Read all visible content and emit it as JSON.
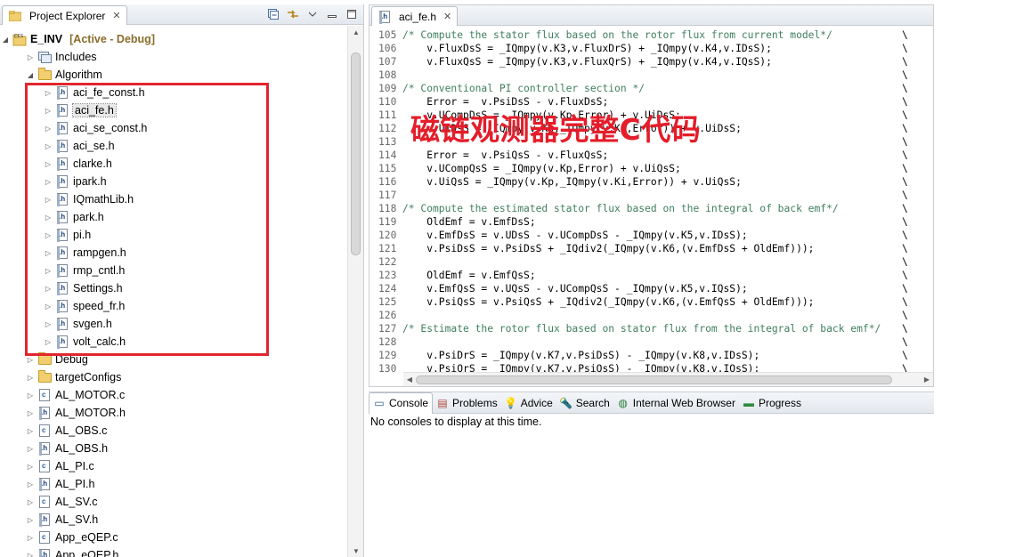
{
  "explorer": {
    "tab_label": "Project Explorer",
    "close_glyph": "✕",
    "tools": [
      "collapse-all-icon",
      "link-with-editor-icon",
      "view-menu-icon",
      "minimize-icon",
      "maximize-icon"
    ],
    "project": {
      "name": "E_INV",
      "status": "[Active - Debug]"
    },
    "items": [
      {
        "label": "Includes",
        "type": "includes",
        "depth": 1,
        "expanded": false
      },
      {
        "label": "Algorithm",
        "type": "folder",
        "depth": 1,
        "expanded": true
      },
      {
        "label": "aci_fe_const.h",
        "type": "h",
        "depth": 2
      },
      {
        "label": "aci_fe.h",
        "type": "h",
        "depth": 2,
        "selected": true
      },
      {
        "label": "aci_se_const.h",
        "type": "h",
        "depth": 2
      },
      {
        "label": "aci_se.h",
        "type": "h",
        "depth": 2
      },
      {
        "label": "clarke.h",
        "type": "h",
        "depth": 2
      },
      {
        "label": "ipark.h",
        "type": "h",
        "depth": 2
      },
      {
        "label": "IQmathLib.h",
        "type": "h",
        "depth": 2
      },
      {
        "label": "park.h",
        "type": "h",
        "depth": 2
      },
      {
        "label": "pi.h",
        "type": "h",
        "depth": 2
      },
      {
        "label": "rampgen.h",
        "type": "h",
        "depth": 2
      },
      {
        "label": "rmp_cntl.h",
        "type": "h",
        "depth": 2
      },
      {
        "label": "Settings.h",
        "type": "h",
        "depth": 2
      },
      {
        "label": "speed_fr.h",
        "type": "h",
        "depth": 2
      },
      {
        "label": "svgen.h",
        "type": "h",
        "depth": 2
      },
      {
        "label": "volt_calc.h",
        "type": "h",
        "depth": 2
      },
      {
        "label": "Debug",
        "type": "folder",
        "depth": 1,
        "expanded": false
      },
      {
        "label": "targetConfigs",
        "type": "folder",
        "depth": 1,
        "expanded": false
      },
      {
        "label": "AL_MOTOR.c",
        "type": "c",
        "depth": 1
      },
      {
        "label": "AL_MOTOR.h",
        "type": "h",
        "depth": 1
      },
      {
        "label": "AL_OBS.c",
        "type": "c",
        "depth": 1
      },
      {
        "label": "AL_OBS.h",
        "type": "h",
        "depth": 1
      },
      {
        "label": "AL_PI.c",
        "type": "c",
        "depth": 1
      },
      {
        "label": "AL_PI.h",
        "type": "h",
        "depth": 1
      },
      {
        "label": "AL_SV.c",
        "type": "c",
        "depth": 1
      },
      {
        "label": "AL_SV.h",
        "type": "h",
        "depth": 1
      },
      {
        "label": "App_eQEP.c",
        "type": "c",
        "depth": 1
      },
      {
        "label": "App_eQEP.h",
        "type": "h",
        "depth": 1
      }
    ]
  },
  "editor": {
    "tab_label": "aci_fe.h",
    "close_glyph": "✕",
    "continuation": "\\",
    "overlay_text": "磁链观测器完整C代码",
    "lines": [
      {
        "n": "105",
        "text": "/* Compute the stator flux based on the rotor flux from current model*/",
        "comment": true
      },
      {
        "n": "106",
        "text": "    v.FluxDsS = _IQmpy(v.K3,v.FluxDrS) + _IQmpy(v.K4,v.IDsS);"
      },
      {
        "n": "107",
        "text": "    v.FluxQsS = _IQmpy(v.K3,v.FluxQrS) + _IQmpy(v.K4,v.IQsS);"
      },
      {
        "n": "108",
        "text": ""
      },
      {
        "n": "109",
        "text": "/* Conventional PI controller section */",
        "comment": true
      },
      {
        "n": "110",
        "text": "    Error =  v.PsiDsS - v.FluxDsS;"
      },
      {
        "n": "111",
        "text": "    v.UCompDsS = _IQmpy(v.Kp,Error) + v.UiDsS;"
      },
      {
        "n": "112",
        "text": "    v.UiDsS = _IQmpy(v.Kp,_IQmpy(v.Ki,Error)) + v.UiDsS;"
      },
      {
        "n": "113",
        "text": ""
      },
      {
        "n": "114",
        "text": "    Error =  v.PsiQsS - v.FluxQsS;"
      },
      {
        "n": "115",
        "text": "    v.UCompQsS = _IQmpy(v.Kp,Error) + v.UiQsS;"
      },
      {
        "n": "116",
        "text": "    v.UiQsS = _IQmpy(v.Kp,_IQmpy(v.Ki,Error)) + v.UiQsS;"
      },
      {
        "n": "117",
        "text": ""
      },
      {
        "n": "118",
        "text": "/* Compute the estimated stator flux based on the integral of back emf*/",
        "comment": true
      },
      {
        "n": "119",
        "text": "    OldEmf = v.EmfDsS;"
      },
      {
        "n": "120",
        "text": "    v.EmfDsS = v.UDsS - v.UCompDsS - _IQmpy(v.K5,v.IDsS);"
      },
      {
        "n": "121",
        "text": "    v.PsiDsS = v.PsiDsS + _IQdiv2(_IQmpy(v.K6,(v.EmfDsS + OldEmf)));"
      },
      {
        "n": "122",
        "text": ""
      },
      {
        "n": "123",
        "text": "    OldEmf = v.EmfQsS;"
      },
      {
        "n": "124",
        "text": "    v.EmfQsS = v.UQsS - v.UCompQsS - _IQmpy(v.K5,v.IQsS);"
      },
      {
        "n": "125",
        "text": "    v.PsiQsS = v.PsiQsS + _IQdiv2(_IQmpy(v.K6,(v.EmfQsS + OldEmf)));"
      },
      {
        "n": "126",
        "text": ""
      },
      {
        "n": "127",
        "text": "/* Estimate the rotor flux based on stator flux from the integral of back emf*/",
        "comment": true
      },
      {
        "n": "128",
        "text": ""
      },
      {
        "n": "129",
        "text": "    v.PsiDrS = _IQmpy(v.K7,v.PsiDsS) - _IQmpy(v.K8,v.IDsS);"
      },
      {
        "n": "130",
        "text": "    v.PsiQrS = _IQmpy(v.K7,v.PsiQsS) - _IQmpy(v.K8,v.IQsS);"
      }
    ]
  },
  "console": {
    "tabs": [
      {
        "label": "Console",
        "icon": "console-icon",
        "glyph": "▭",
        "color": "#2f5b8f",
        "active": true
      },
      {
        "label": "Problems",
        "icon": "problems-icon",
        "glyph": "▤",
        "color": "#b0483a"
      },
      {
        "label": "Advice",
        "icon": "lightbulb-icon",
        "glyph": "💡",
        "color": "#d9b21b"
      },
      {
        "label": "Search",
        "icon": "search-icon",
        "glyph": "🔦",
        "color": "#555555"
      },
      {
        "label": "Internal Web Browser",
        "icon": "globe-icon",
        "glyph": "◍",
        "color": "#2a7a3a"
      },
      {
        "label": "Progress",
        "icon": "progress-icon",
        "glyph": "▬",
        "color": "#2f8a3f"
      }
    ],
    "message": "No consoles to display at this time."
  },
  "colors": {
    "highlight_box": "#e0262f",
    "overlay_text": "#e41d2a",
    "comment": "#3f7f5f"
  }
}
